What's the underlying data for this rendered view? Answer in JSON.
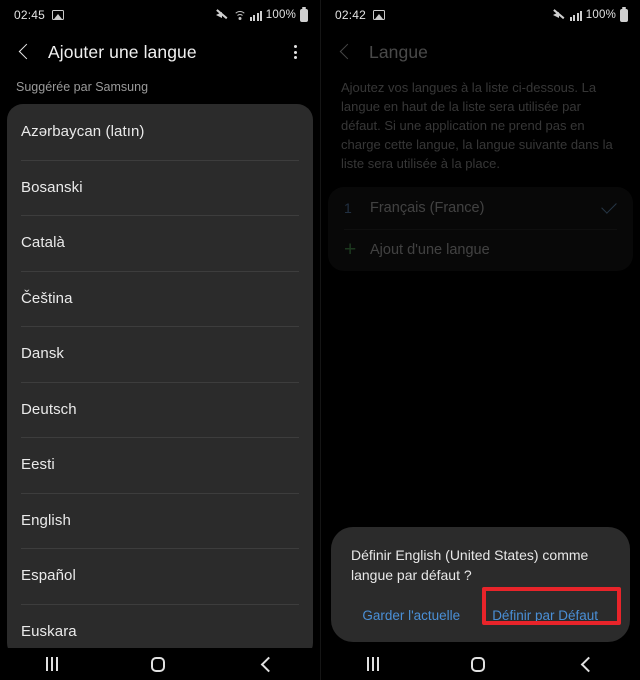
{
  "left_screen": {
    "statusbar": {
      "time": "02:45",
      "battery_text": "100%",
      "icons": [
        "screenshot-icon",
        "mute-icon",
        "wifi-icon",
        "signal-icon",
        "battery-icon"
      ]
    },
    "appbar": {
      "back_label": "back-arrow",
      "title": "Ajouter une langue",
      "overflow_label": "more-options"
    },
    "section_label": "Suggérée par Samsung",
    "languages": [
      "Azərbaycan (latın)",
      "Bosanski",
      "Català",
      "Čeština",
      "Dansk",
      "Deutsch",
      "Eesti",
      "English",
      "Español",
      "Euskara"
    ],
    "navbar": {
      "recents": "recents",
      "home": "home",
      "back": "back"
    }
  },
  "right_screen": {
    "statusbar": {
      "time": "02:42",
      "battery_text": "100%",
      "icons": [
        "screenshot-icon",
        "mute-icon",
        "signal-icon",
        "battery-icon"
      ]
    },
    "appbar": {
      "back_label": "back-arrow",
      "title": "Langue"
    },
    "description": "Ajoutez vos langues à la liste ci-dessous. La langue en haut de la liste sera utilisée par défaut. Si une application ne prend pas en charge cette langue, la langue suivante dans la liste sera utilisée à la place.",
    "language_rows": [
      {
        "index": "1",
        "label": "Français (France)",
        "checked": true
      },
      {
        "index": "+",
        "label": "Ajout d'une langue",
        "checked": false
      }
    ],
    "dialog": {
      "message": "Définir English (United States) comme langue par défaut ?",
      "keep_button": "Garder l'actuelle",
      "set_default_button": "Définir par Défaut",
      "highlight_color": "#e8242a",
      "button_color": "#4a8fd6"
    },
    "navbar": {
      "recents": "recents",
      "home": "home",
      "back": "back"
    }
  }
}
